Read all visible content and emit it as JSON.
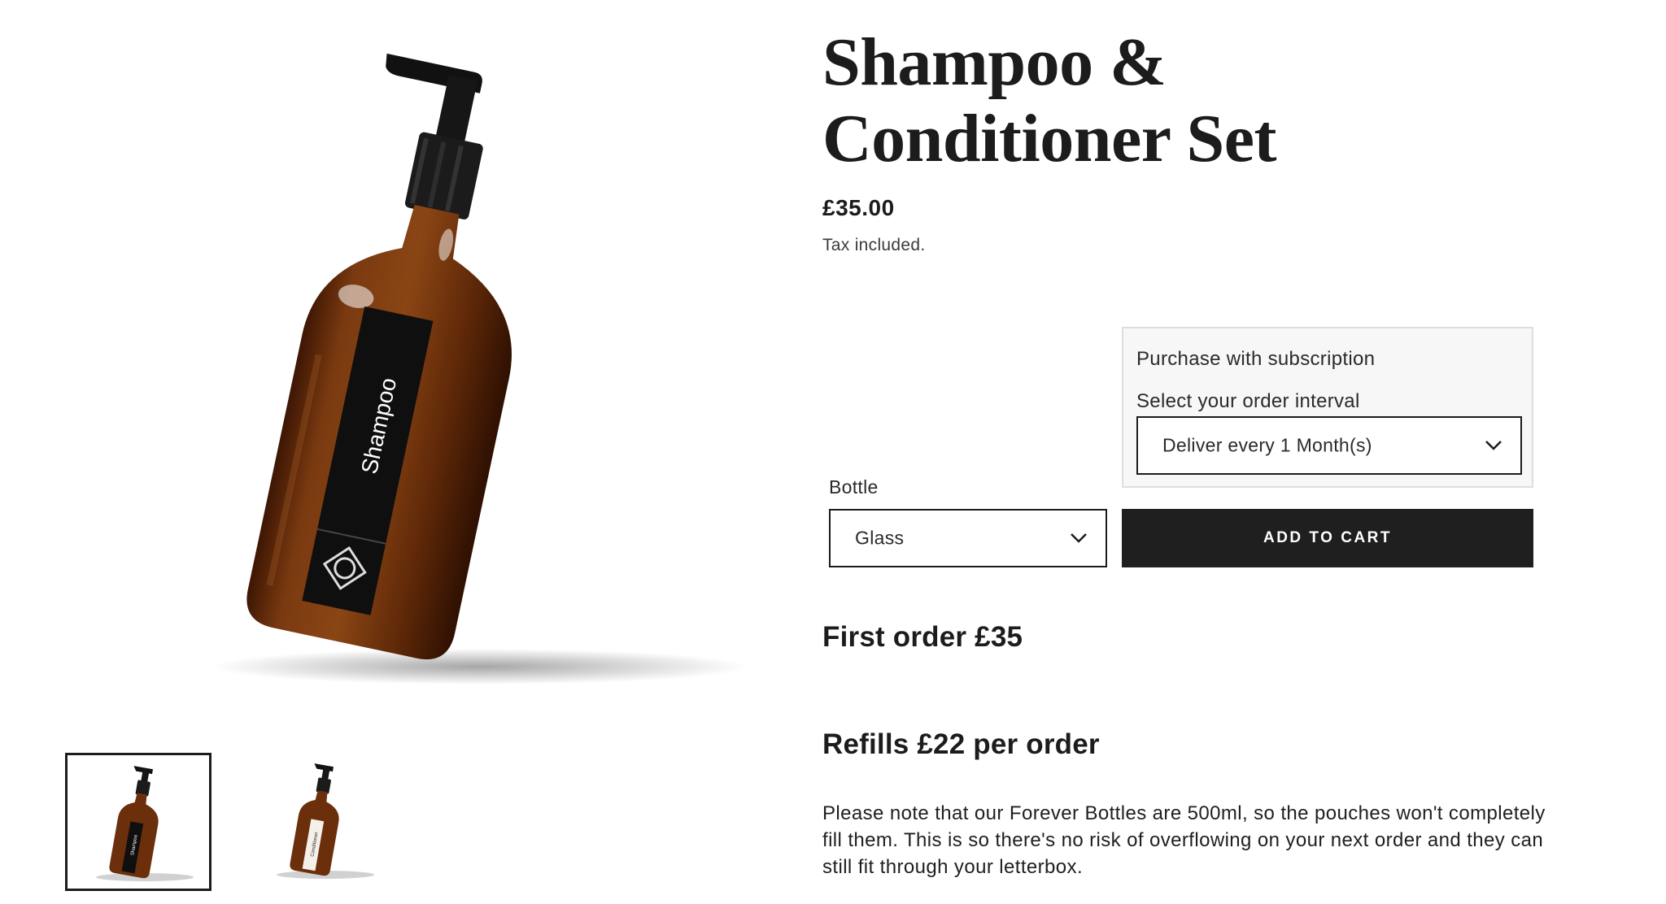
{
  "product": {
    "title": "Shampoo & Conditioner Set",
    "price": "£35.00",
    "tax_note": "Tax included.",
    "main_image_label": "Shampoo",
    "thumbnail_labels": [
      "Shampoo",
      "Conditioner"
    ]
  },
  "subscription": {
    "heading": "Purchase with subscription",
    "interval_label": "Select your order interval",
    "interval_value": "Deliver every 1 Month(s)"
  },
  "variant": {
    "label": "Bottle",
    "value": "Glass"
  },
  "cart": {
    "button_label": "ADD TO CART"
  },
  "pricing": {
    "first_order": "First order £35",
    "refills": "Refills £22 per order"
  },
  "note": "Please note that our Forever Bottles are 500ml, so the pouches won't completely fill them. This is so there's no risk of overflowing on your next order and they can still fit through your letterbox.",
  "colors": {
    "bottle_amber": "#6b2f0c",
    "cart_button": "#1f1f1f",
    "subscription_box": "#f7f7f7"
  }
}
